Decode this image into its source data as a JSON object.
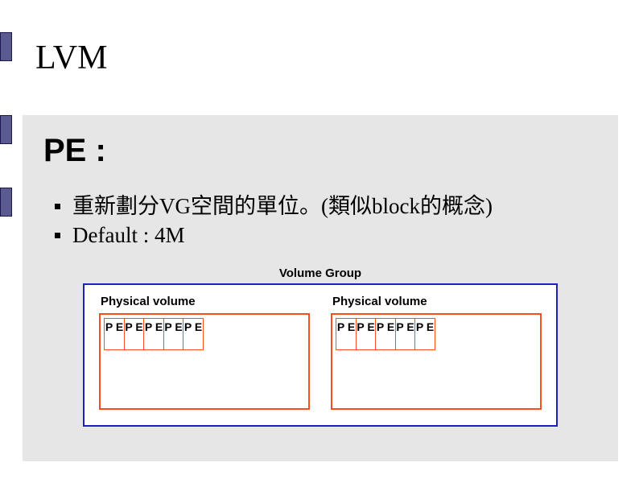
{
  "title": "LVM",
  "subheading": "PE :",
  "bullets": [
    "重新劃分VG空間的單位。(類似block的概念)",
    " Default : 4M"
  ],
  "diagram": {
    "vg_label": "Volume Group",
    "physical_volumes": [
      {
        "label": "Physical volume",
        "pe_cells": [
          "P E",
          "P E",
          "P E",
          "P E",
          "P E"
        ]
      },
      {
        "label": "Physical volume",
        "pe_cells": [
          "P E",
          "P E",
          "P E",
          "P E",
          "P E"
        ]
      }
    ]
  },
  "left_marks_top": [
    40,
    143,
    233
  ]
}
